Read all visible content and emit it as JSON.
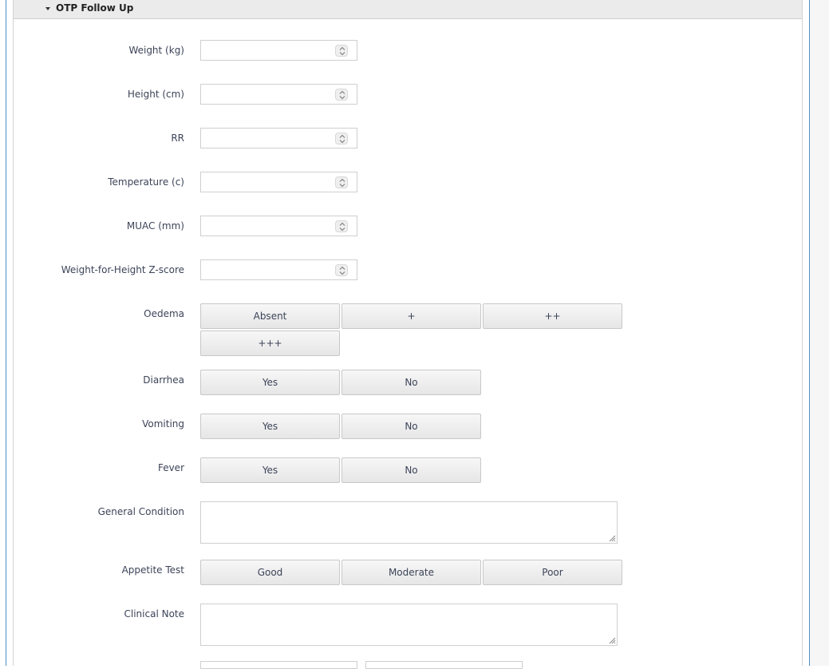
{
  "section": {
    "title": "OTP Follow Up"
  },
  "fields": {
    "weight": {
      "label": "Weight (kg)",
      "value": ""
    },
    "height": {
      "label": "Height (cm)",
      "value": ""
    },
    "rr": {
      "label": "RR",
      "value": ""
    },
    "temperature": {
      "label": "Temperature (c)",
      "value": ""
    },
    "muac": {
      "label": "MUAC (mm)",
      "value": ""
    },
    "whz": {
      "label": "Weight-for-Height Z-score",
      "value": ""
    }
  },
  "oedema": {
    "label": "Oedema",
    "options": [
      "Absent",
      "+",
      "++",
      "+++"
    ]
  },
  "diarrhea": {
    "label": "Diarrhea",
    "options": [
      "Yes",
      "No"
    ]
  },
  "vomiting": {
    "label": "Vomiting",
    "options": [
      "Yes",
      "No"
    ]
  },
  "fever": {
    "label": "Fever",
    "options": [
      "Yes",
      "No"
    ]
  },
  "general_condition": {
    "label": "General Condition",
    "value": ""
  },
  "appetite_test": {
    "label": "Appetite Test",
    "options": [
      "Good",
      "Moderate",
      "Poor"
    ]
  },
  "clinical_note": {
    "label": "Clinical Note",
    "value": ""
  },
  "icons": {
    "spinner": "up-down-chevron-icon",
    "collapse": "caret-down-icon",
    "resize": "resize-grip-icon"
  },
  "colors": {
    "frame_accent": "#4a90c8",
    "header_bg": "#ebebeb",
    "button_bg": "#eeeeee",
    "label_text": "#3c4458"
  }
}
